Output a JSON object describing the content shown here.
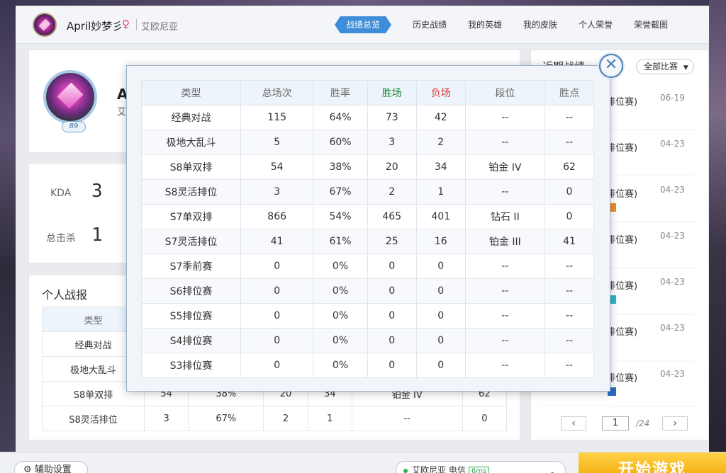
{
  "header": {
    "username": "April妙梦彡",
    "gender_symbol": "♀",
    "server": "艾欧尼亚",
    "nav": [
      "战绩总览",
      "历史战绩",
      "我的英雄",
      "我的皮肤",
      "个人荣誉",
      "荣誉截图"
    ],
    "active_nav": "战绩总览"
  },
  "profile": {
    "level": "89",
    "name_fragment": "A",
    "sub_fragment": "艾"
  },
  "stats": {
    "kda_label": "KDA",
    "kda_value": "3",
    "kills_label": "总击杀",
    "kills_value": "1"
  },
  "report": {
    "title": "个人战报",
    "header_type": "类型",
    "rows": [
      {
        "type": "经典对战"
      },
      {
        "type": "极地大乱斗"
      },
      {
        "type": "S8单双排",
        "total": "54",
        "winrate": "38%",
        "wins": "20",
        "losses": "34",
        "rank": "铂金 IV",
        "points": "62"
      },
      {
        "type": "S8灵活排位",
        "total": "3",
        "winrate": "67%",
        "wins": "2",
        "losses": "1",
        "rank": "--",
        "points": "0"
      }
    ]
  },
  "recent": {
    "title": "近期战绩",
    "filter": "全部比赛",
    "items": [
      {
        "mode": "排位赛)",
        "date": "06-19"
      },
      {
        "mode": "排位赛)",
        "date": "04-23"
      },
      {
        "mode": "排位赛)",
        "date": "04-23"
      },
      {
        "mode": "排位赛)",
        "date": "04-23"
      },
      {
        "mode": "排位赛)",
        "date": "04-23"
      },
      {
        "mode": "排位赛)",
        "date": "04-23"
      },
      {
        "mode": "排位赛)",
        "date": "04-23"
      }
    ],
    "pager": {
      "prev": "‹",
      "current": "1",
      "total": "/24",
      "next": "›"
    }
  },
  "popup": {
    "close": "✕",
    "columns": [
      "类型",
      "总场次",
      "胜率",
      "胜场",
      "负场",
      "段位",
      "胜点"
    ],
    "rows": [
      [
        "经典对战",
        "115",
        "64%",
        "73",
        "42",
        "--",
        "--"
      ],
      [
        "极地大乱斗",
        "5",
        "60%",
        "3",
        "2",
        "--",
        "--"
      ],
      [
        "S8单双排",
        "54",
        "38%",
        "20",
        "34",
        "铂金 IV",
        "62"
      ],
      [
        "S8灵活排位",
        "3",
        "67%",
        "2",
        "1",
        "--",
        "0"
      ],
      [
        "S7单双排",
        "866",
        "54%",
        "465",
        "401",
        "钻石 II",
        "0"
      ],
      [
        "S7灵活排位",
        "41",
        "61%",
        "25",
        "16",
        "铂金 III",
        "41"
      ],
      [
        "S7季前赛",
        "0",
        "0%",
        "0",
        "0",
        "--",
        "--"
      ],
      [
        "S6排位赛",
        "0",
        "0%",
        "0",
        "0",
        "--",
        "--"
      ],
      [
        "S5排位赛",
        "0",
        "0%",
        "0",
        "0",
        "--",
        "--"
      ],
      [
        "S4排位赛",
        "0",
        "0%",
        "0",
        "0",
        "--",
        "--"
      ],
      [
        "S3排位赛",
        "0",
        "0%",
        "0",
        "0",
        "--",
        "--"
      ]
    ]
  },
  "bottom": {
    "assist": "辅助设置",
    "server_status": "艾欧尼亚 电信",
    "ping": "6ms",
    "start": "开始游戏"
  },
  "colors": {
    "accent": "#3d8dd8",
    "win": "#1a8a3a",
    "lose": "#e03a3a",
    "start": "#f5b214"
  }
}
